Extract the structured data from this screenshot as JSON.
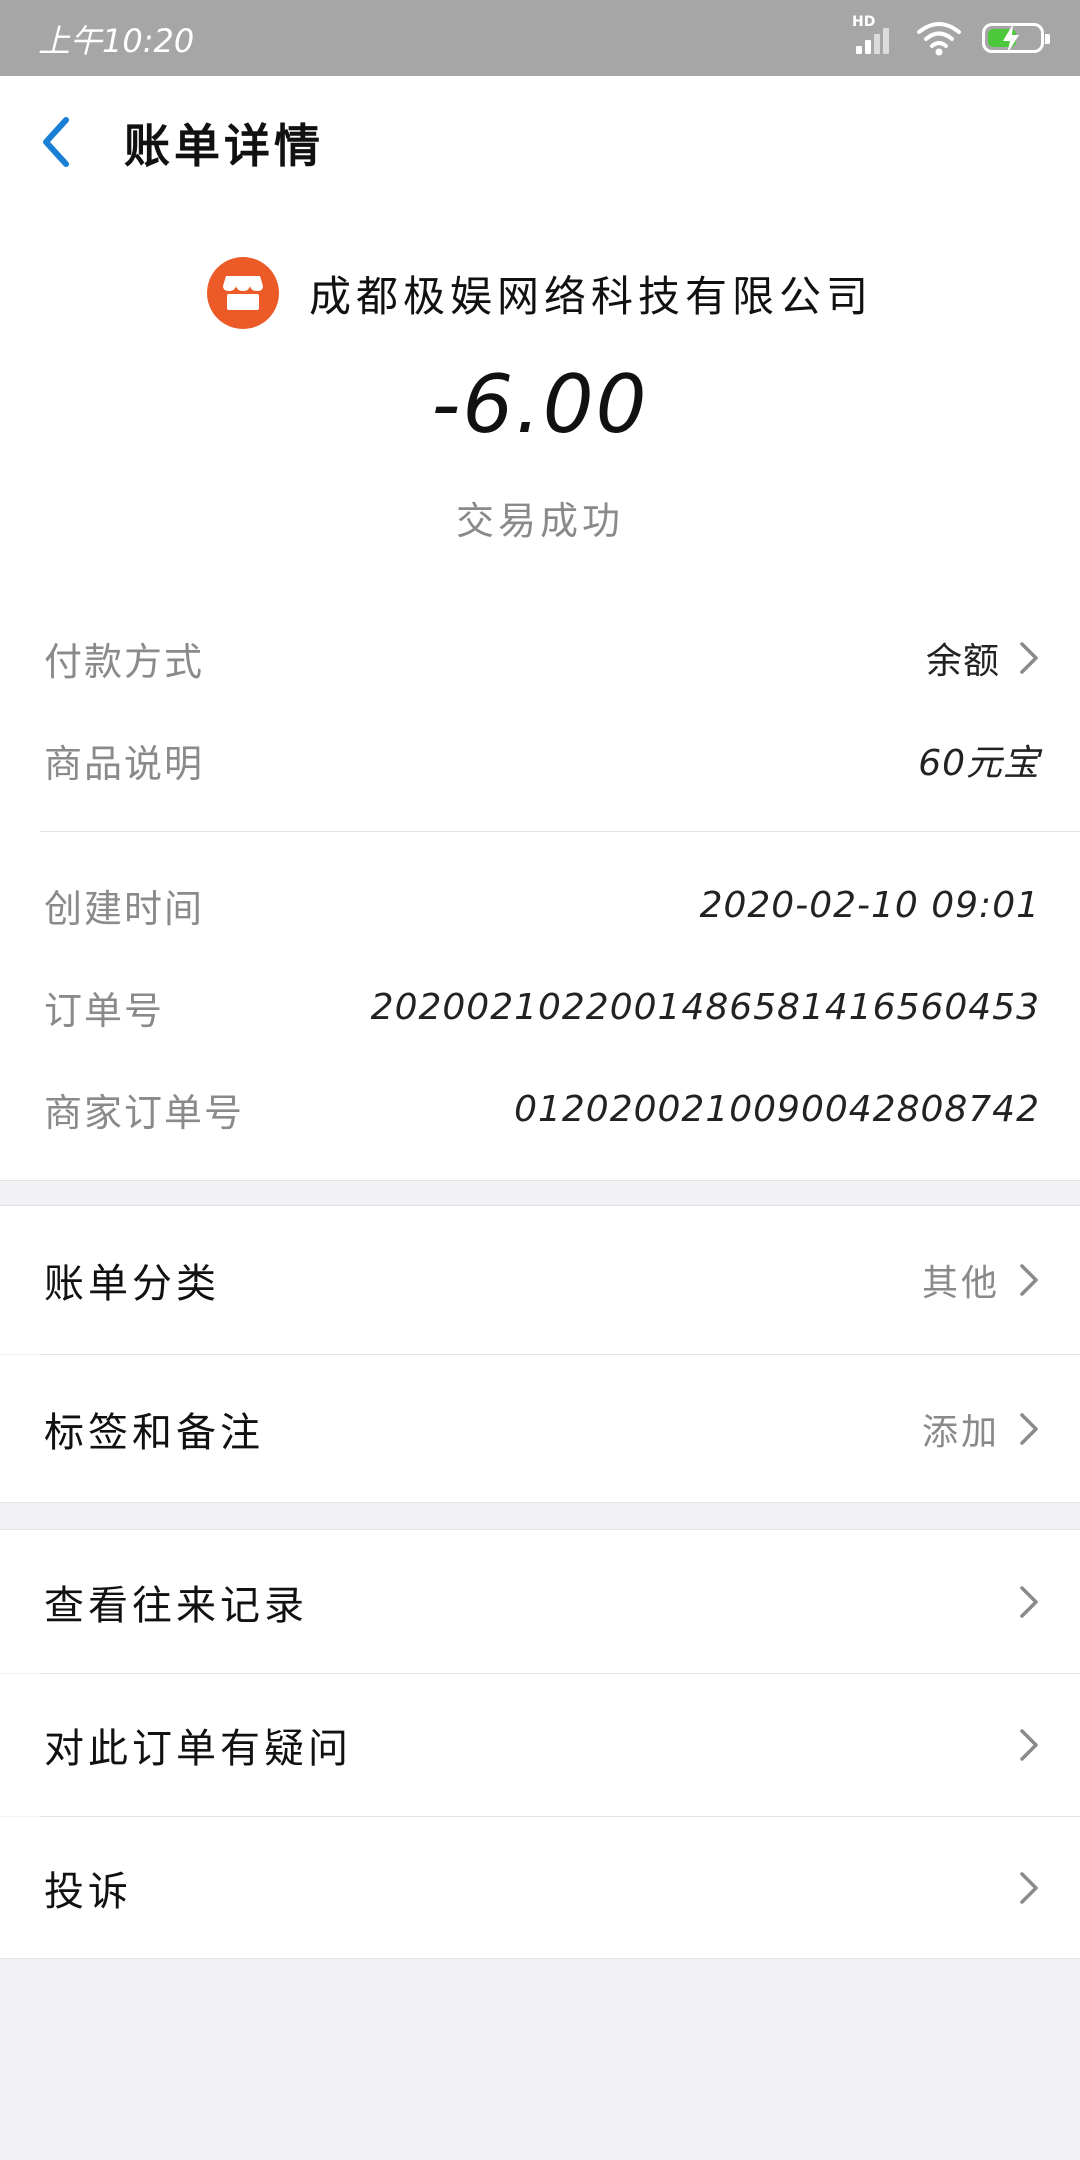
{
  "status_bar": {
    "time": "上午10:20",
    "network_badge": "HD",
    "battery_color": "#4cc93a"
  },
  "nav": {
    "title": "账单详情",
    "back_icon": "chevron-left-icon",
    "accent": "#1a7fd4"
  },
  "merchant": {
    "name": "成都极娱网络科技有限公司",
    "logo_icon": "shop-icon",
    "logo_color": "#ec5a28"
  },
  "amount": "-6.00",
  "trade_status": "交易成功",
  "details": {
    "payment_method_label": "付款方式",
    "payment_method_value": "余额",
    "goods_label": "商品说明",
    "goods_value": "60元宝",
    "created_label": "创建时间",
    "created_value": "2020-02-10 09:01",
    "order_no_label": "订单号",
    "order_no_value": "2020021022001486581416560453",
    "merchant_order_label": "商家订单号",
    "merchant_order_value": "0120200210090042808742"
  },
  "category": {
    "label": "账单分类",
    "value": "其他"
  },
  "tags": {
    "label": "标签和备注",
    "value": "添加"
  },
  "actions": {
    "history_label": "查看往来记录",
    "question_label": "对此订单有疑问",
    "complaint_label": "投诉"
  }
}
